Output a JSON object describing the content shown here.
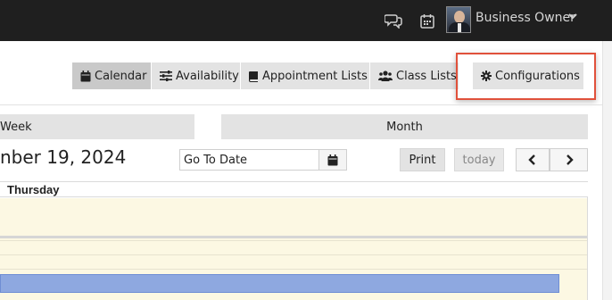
{
  "topbar": {
    "user_name": "Business Owner",
    "icons": [
      "chat-icon",
      "calendar-icon",
      "chevron-down-icon"
    ]
  },
  "tabs": [
    {
      "label": "Calendar",
      "icon": "calendar-icon",
      "active": true
    },
    {
      "label": "Availability",
      "icon": "sliders-icon",
      "active": false
    },
    {
      "label": "Appointment Lists",
      "icon": "book-icon",
      "active": false
    },
    {
      "label": "Class Lists",
      "icon": "users-icon",
      "active": false
    },
    {
      "label": "Configurations",
      "icon": "gear-icon",
      "active": false,
      "highlighted": true
    }
  ],
  "views": {
    "week": "Week",
    "month": "Month"
  },
  "date_title": "nber 19, 2024",
  "goto": {
    "value": "Go To Date",
    "button_icon": "calendar-icon"
  },
  "actions": {
    "print": "Print",
    "today": "today",
    "prev_icon": "chevron-left-icon",
    "next_icon": "chevron-right-icon"
  },
  "calendar": {
    "day_header": "Thursday"
  },
  "colors": {
    "topbar": "#1f1f1f",
    "highlight": "#e0513b",
    "event": "#8ea8e0",
    "slot_bg": "#fcf8e3"
  }
}
